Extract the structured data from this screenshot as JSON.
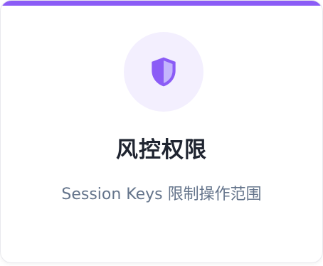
{
  "card": {
    "accent_color": "#8b5cf6",
    "icon": "shield-icon",
    "title": "风控权限",
    "subtitle": "Session Keys 限制操作范围"
  }
}
